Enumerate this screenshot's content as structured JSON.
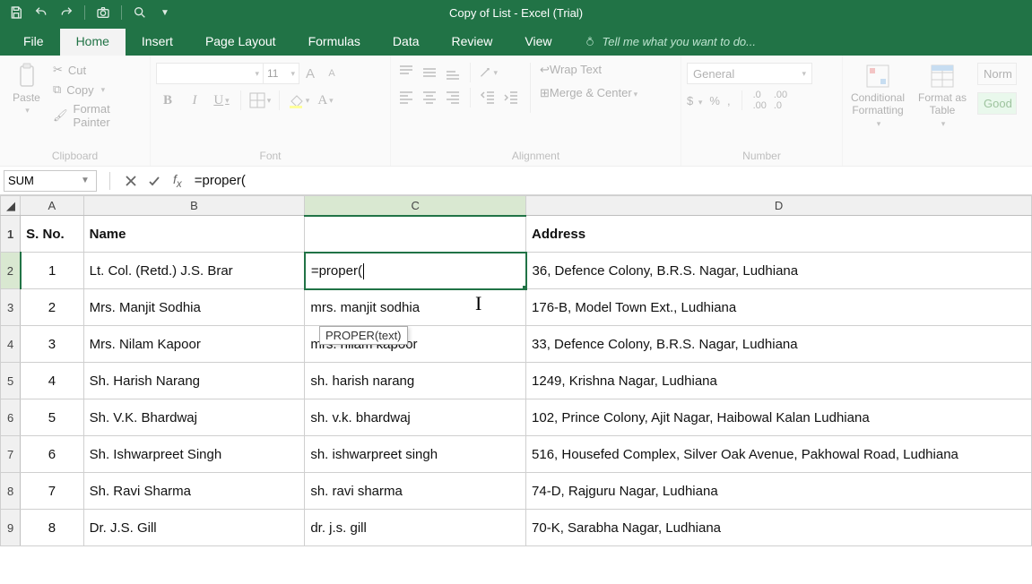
{
  "title": "Copy of List - Excel (Trial)",
  "tabs": {
    "file": "File",
    "home": "Home",
    "insert": "Insert",
    "page_layout": "Page Layout",
    "formulas": "Formulas",
    "data": "Data",
    "review": "Review",
    "view": "View"
  },
  "tellme": "Tell me what you want to do...",
  "clipboard": {
    "paste": "Paste",
    "cut": "Cut",
    "copy": "Copy",
    "format_painter": "Format Painter",
    "label": "Clipboard"
  },
  "font": {
    "name": "",
    "size": "11",
    "label": "Font"
  },
  "alignment": {
    "wrap": "Wrap Text",
    "merge": "Merge & Center",
    "label": "Alignment"
  },
  "number": {
    "format": "General",
    "label": "Number"
  },
  "styles": {
    "conditional": "Conditional Formatting",
    "format_as_table": "Format as Table",
    "normal": "Norm",
    "good": "Good"
  },
  "name_box": "SUM",
  "formula": "=proper(",
  "tooltip": "PROPER(text)",
  "headers": {
    "A": "A",
    "B": "B",
    "C": "C",
    "D": "D"
  },
  "rows": [
    {
      "n": "1",
      "A": "S. No.",
      "B": "Name",
      "C": "",
      "D": "Address",
      "hdr": true
    },
    {
      "n": "2",
      "A": "1",
      "B": "Lt. Col. (Retd.) J.S. Brar",
      "C": "=proper(",
      "D": "36, Defence Colony, B.R.S. Nagar, Ludhiana",
      "active": true
    },
    {
      "n": "3",
      "A": "2",
      "B": "Mrs. Manjit Sodhia",
      "C": "mrs. manjit sodhia",
      "D": "176-B, Model Town Ext., Ludhiana"
    },
    {
      "n": "4",
      "A": "3",
      "B": "Mrs. Nilam Kapoor",
      "C": "mrs. nilam kapoor",
      "D": "33, Defence Colony, B.R.S. Nagar, Ludhiana"
    },
    {
      "n": "5",
      "A": "4",
      "B": "Sh. Harish Narang",
      "C": "sh. harish narang",
      "D": "1249, Krishna Nagar, Ludhiana"
    },
    {
      "n": "6",
      "A": "5",
      "B": "Sh. V.K. Bhardwaj",
      "C": "sh. v.k. bhardwaj",
      "D": "102, Prince Colony, Ajit Nagar, Haibowal Kalan Ludhiana"
    },
    {
      "n": "7",
      "A": "6",
      "B": "Sh. Ishwarpreet Singh",
      "C": "sh. ishwarpreet singh",
      "D": "516, Housefed Complex, Silver Oak Avenue, Pakhowal Road, Ludhiana"
    },
    {
      "n": "8",
      "A": "7",
      "B": "Sh. Ravi Sharma",
      "C": "sh. ravi sharma",
      "D": "74-D, Rajguru Nagar, Ludhiana"
    },
    {
      "n": "9",
      "A": "8",
      "B": "Dr. J.S. Gill",
      "C": "dr. j.s. gill",
      "D": "70-K, Sarabha Nagar, Ludhiana"
    }
  ]
}
